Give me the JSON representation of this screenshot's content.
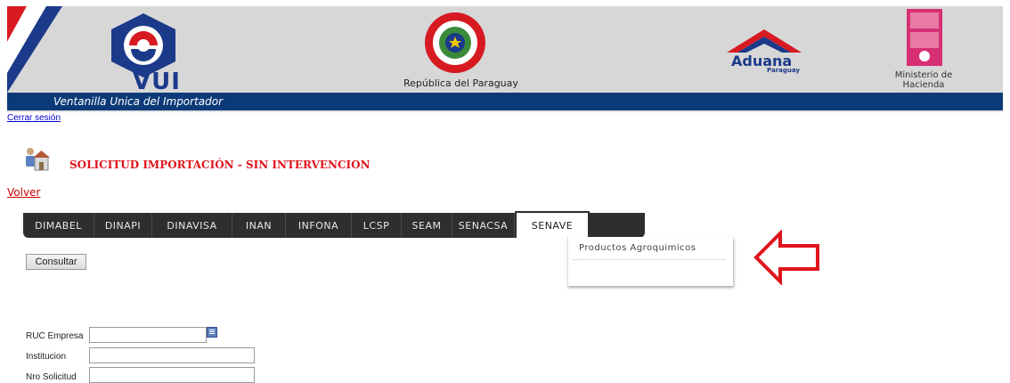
{
  "header": {
    "vui_logo_text": "VUI",
    "country_text": "República del Paraguay",
    "aduana_text": "Aduana",
    "aduana_subtext": "Paraguay",
    "ministerio_text": "Ministerio de Hacienda",
    "band_text": "Ventanilla Unica del Importador"
  },
  "session": {
    "logout_label": "Cerrar sesión"
  },
  "page": {
    "title": "SOLICITUD IMPORTACIÓN - SIN INTERVENCION",
    "back_label": "Volver"
  },
  "tabs": [
    {
      "label": "DIMABEL"
    },
    {
      "label": "DINAPI"
    },
    {
      "label": "DINAVISA"
    },
    {
      "label": "INAN"
    },
    {
      "label": "INFONA"
    },
    {
      "label": "LCSP"
    },
    {
      "label": "SEAM"
    },
    {
      "label": "SENACSA"
    },
    {
      "label": "SENAVE",
      "active": true
    }
  ],
  "dropdown": {
    "items": [
      "Productos Agroquimicos"
    ]
  },
  "actions": {
    "consultar_label": "Consultar"
  },
  "form": {
    "ruc_label": "RUC Empresa",
    "ruc_value": "",
    "institucion_label": "Institucion",
    "institucion_value": "",
    "nro_label": "Nro Solicitud",
    "nro_value": ""
  },
  "colors": {
    "title_red": "#e0141b",
    "band_blue": "#0c3a78",
    "tabbar_dark": "#2e2e2e",
    "arrow_red": "#e0141b"
  }
}
